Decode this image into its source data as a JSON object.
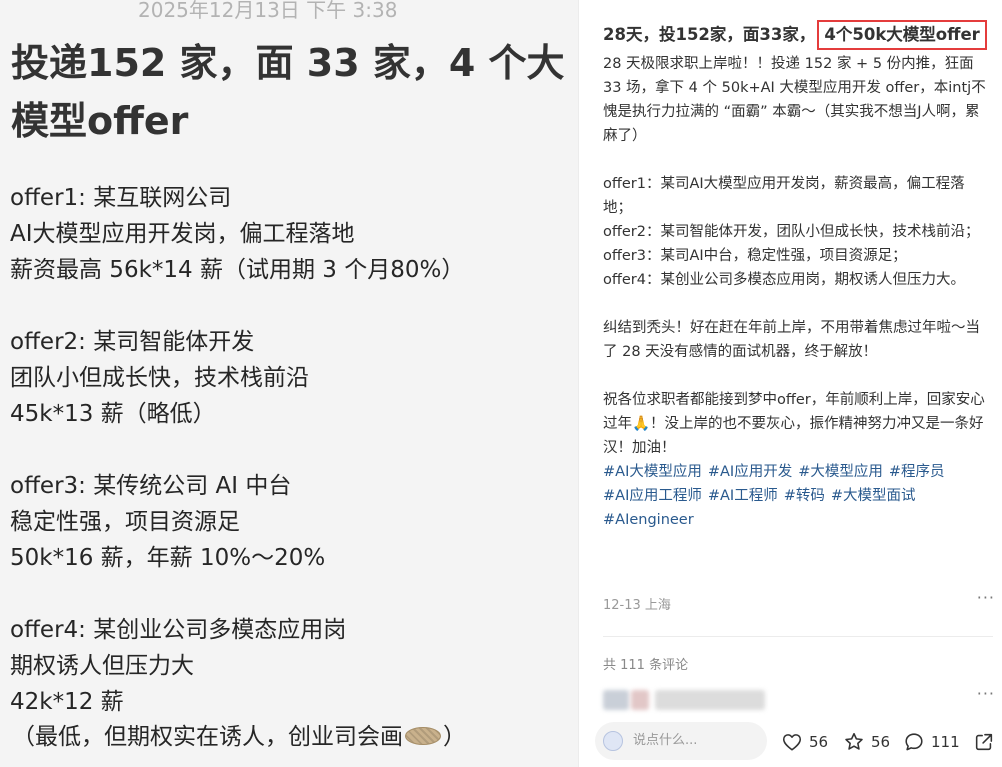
{
  "image_card": {
    "date": "2025年12月13日 下午 3:38",
    "title": "投递152 家，面 33 家，4 个大模型offer",
    "lines": [
      "offer1: 某互联网公司",
      "AI大模型应用开发岗，偏工程落地",
      "薪资最高 56k*14 薪（试用期 3 个月80%）",
      "offer2: 某司智能体开发",
      "团队小但成长快，技术栈前沿",
      "45k*13 薪（略低）",
      "offer3: 某传统公司 AI 中台",
      "稳定性强，项目资源足",
      "50k*16 薪，年薪 10%～20%",
      "offer4: 某创业公司多模态应用岗",
      "期权诱人但压力大",
      "42k*12 薪"
    ],
    "last_line_before": "（最低，但期权实在诱人，创业司会画",
    "last_line_after": "）",
    "last_line_icon": "cookie-icon"
  },
  "post": {
    "title_prefix": "28天，投152家，面33家，",
    "title_highlight": "4个50k大模型offer",
    "paragraphs": [
      "28 天极限求职上岸啦！！投递 152 家 + 5 份内推，狂面 33 场，拿下 4 个 50k+AI 大模型应用开发 offer，本intj不愧是执行力拉满的 “面霸” 本霸～（其实我不想当J人啊，累麻了）",
      "offer1：某司AI大模型应用开发岗，薪资最高，偏工程落地；",
      "offer2：某司智能体开发，团队小但成长快，技术栈前沿；",
      "offer3：某司AI中台，稳定性强，项目资源足；",
      "offer4：某创业公司多模态应用岗，期权诱人但压力大。",
      "纠结到秃头！好在赶在年前上岸，不用带着焦虑过年啦～当了 28 天没有感情的面试机器，终于解放！",
      "祝各位求职者都能接到梦中offer，年前顺利上岸，回家安心过年🙏！没上岸的也不要灰心，振作精神努力冲又是一条好汉！加油！"
    ],
    "hashtags": [
      "#AI大模型应用",
      "#AI应用开发",
      "#大模型应用",
      "#程序员",
      "#AI应用工程师",
      "#AI工程师",
      "#转码",
      "#大模型面试",
      "#AIengineer"
    ],
    "meta": "12-13 上海",
    "more_icon": "···",
    "comment_count": "共 111 条评论"
  },
  "bottom_bar": {
    "input_placeholder": "说点什么...",
    "likes": "56",
    "collects": "56",
    "comments": "111"
  },
  "colors": {
    "highlight_border": "#e43c3c",
    "hashtag": "#2a5a8e",
    "left_bg": "#f4f4f4"
  }
}
